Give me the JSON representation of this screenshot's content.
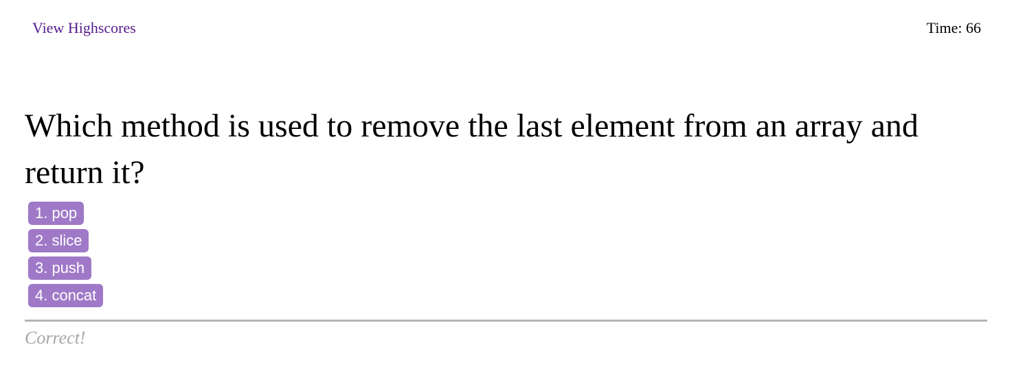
{
  "header": {
    "highscores_link": "View Highscores",
    "timer_label": "Time:",
    "timer_value": "66"
  },
  "quiz": {
    "question": "Which method is used to remove the last element from an array and return it?",
    "answers": [
      {
        "label": "1. pop"
      },
      {
        "label": "2. slice"
      },
      {
        "label": "3. push"
      },
      {
        "label": "4. concat"
      }
    ],
    "feedback": "Correct!"
  },
  "colors": {
    "link": "#551a8b",
    "answer_button": "#9f79c7",
    "feedback_text": "#a6a6a6",
    "divider": "#b3b3b3"
  }
}
